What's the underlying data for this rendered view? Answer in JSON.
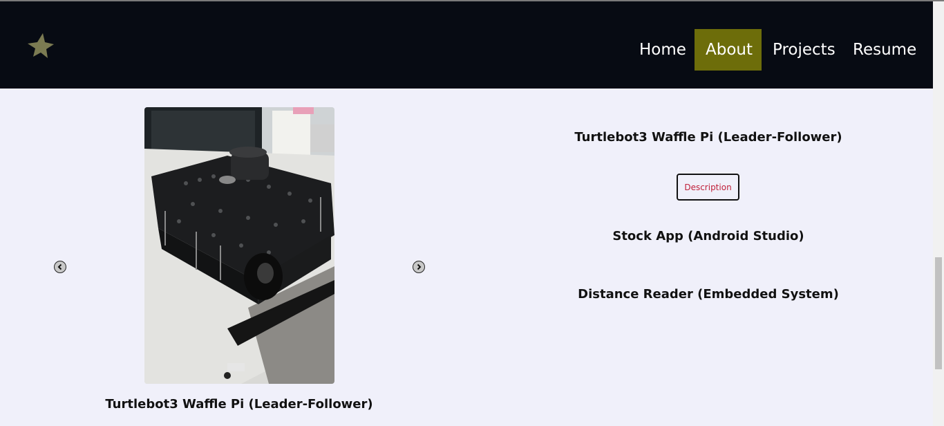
{
  "nav": {
    "items": [
      {
        "label": "Home",
        "active": false
      },
      {
        "label": "About",
        "active": true
      },
      {
        "label": "Projects",
        "active": false
      },
      {
        "label": "Resume",
        "active": false
      }
    ]
  },
  "carousel": {
    "caption": "Turtlebot3 Waffle Pi (Leader-Follower)"
  },
  "projects": {
    "items": [
      {
        "title": "Turtlebot3 Waffle Pi (Leader-Follower)"
      },
      {
        "title": "Stock App (Android Studio)"
      },
      {
        "title": "Distance Reader (Embedded System)"
      }
    ],
    "description_label": "Description"
  },
  "colors": {
    "nav_bg": "#070b13",
    "active_bg": "#6d6d0a",
    "page_bg": "#f0f0fa",
    "button_text": "#c0203a"
  }
}
